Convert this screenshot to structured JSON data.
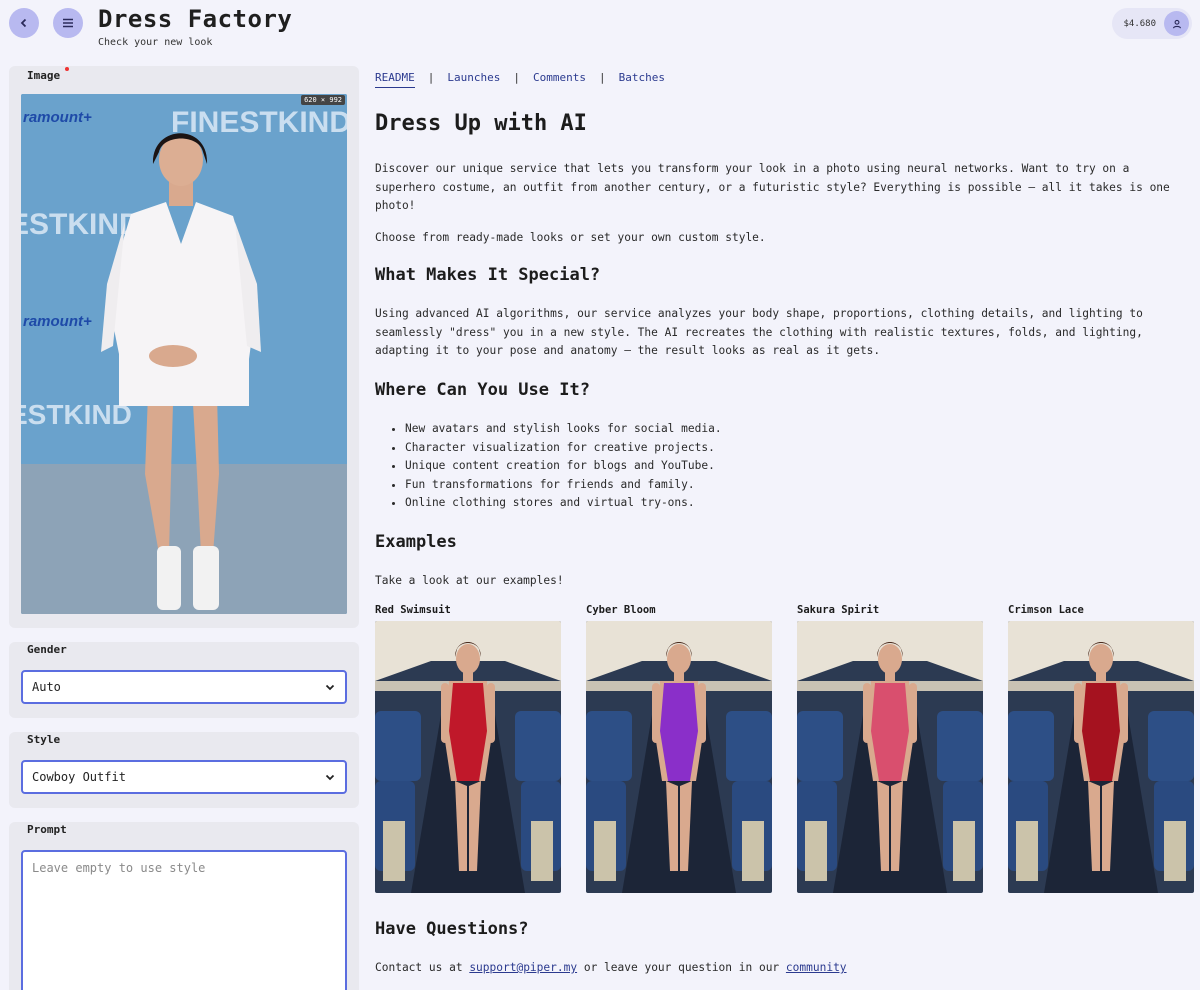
{
  "header": {
    "title": "Dress Factory",
    "subtitle": "Check your new look",
    "balance": "$4.680"
  },
  "left": {
    "image_label": "Image",
    "image_size": "620 × 992",
    "gender_label": "Gender",
    "gender_value": "Auto",
    "style_label": "Style",
    "style_value": "Cowboy Outfit",
    "prompt_label": "Prompt",
    "prompt_placeholder": "Leave empty to use style"
  },
  "tabs": [
    "README",
    "Launches",
    "Comments",
    "Batches"
  ],
  "readme": {
    "title": "Dress Up with AI",
    "intro": "Discover our unique service that lets you transform your look in a photo using neural networks. Want to try on a superhero costume, an outfit from another century, or a futuristic style? Everything is possible — all it takes is one photo!",
    "intro2": "Choose from ready-made looks or set your own custom style.",
    "special_title": "What Makes It Special?",
    "special_text": "Using advanced AI algorithms, our service analyzes your body shape, proportions, clothing details, and lighting to seamlessly \"dress\" you in a new style. The AI recreates the clothing with realistic textures, folds, and lighting, adapting it to your pose and anatomy — the result looks as real as it gets.",
    "where_title": "Where Can You Use It?",
    "uses": [
      "New avatars and stylish looks for social media.",
      "Character visualization for creative projects.",
      "Unique content creation for blogs and YouTube.",
      "Fun transformations for friends and family.",
      "Online clothing stores and virtual try-ons."
    ],
    "examples_title": "Examples",
    "examples_text": "Take a look at our examples!",
    "examples": [
      {
        "name": "Red Swimsuit",
        "color": "#c0182a"
      },
      {
        "name": "Cyber Bloom",
        "color": "#8a2fc9"
      },
      {
        "name": "Sakura Spirit",
        "color": "#d94f6e"
      },
      {
        "name": "Crimson Lace",
        "color": "#a5121f"
      }
    ],
    "questions_title": "Have Questions?",
    "contact_prefix": "Contact us at",
    "contact_email": "support@piper.my",
    "contact_middle": "or leave your question in our",
    "contact_link": "community"
  },
  "colors": {
    "accent": "#5b6de0",
    "button": "#b8b9f0",
    "link": "#2b3a8f"
  }
}
